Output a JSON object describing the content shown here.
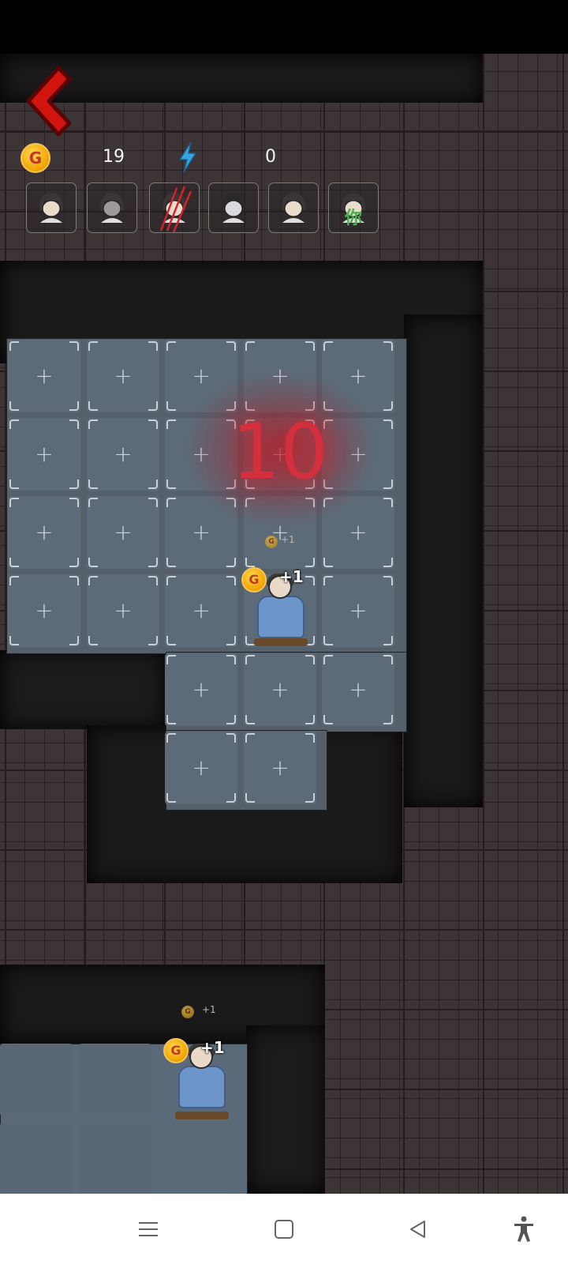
{
  "hud": {
    "coins": "19",
    "energy": "0",
    "coin_symbol": "G",
    "characters": [
      {
        "name": "girl-avatar-1"
      },
      {
        "name": "girl-bow-avatar"
      },
      {
        "name": "ghost-claw-avatar"
      },
      {
        "name": "pale-girl-avatar"
      },
      {
        "name": "girl-avatar-2"
      },
      {
        "name": "girl-avatar-you",
        "tag": "你"
      }
    ]
  },
  "board": {
    "countdown": "10",
    "plus_symbol": "+",
    "bed_income": "+1",
    "coin_float": "+1"
  },
  "colors": {
    "countdown": "#d32f3c",
    "back_arrow": "#d2140f",
    "coin": "#f0a400",
    "energy": "#37a6e0",
    "tag_you": "#4caf50"
  },
  "navbar": {
    "items": [
      "menu-icon",
      "home-icon",
      "back-icon",
      "accessibility-icon"
    ]
  }
}
